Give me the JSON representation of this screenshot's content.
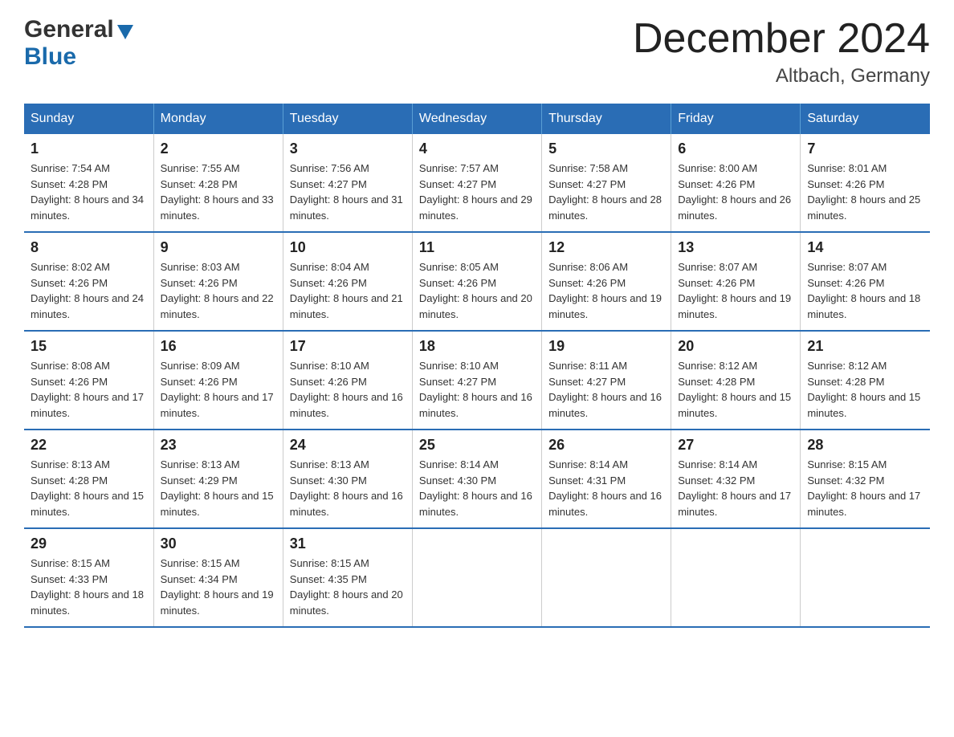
{
  "header": {
    "logo_text1": "General",
    "logo_text2": "Blue",
    "title": "December 2024",
    "location": "Altbach, Germany"
  },
  "calendar": {
    "days_of_week": [
      "Sunday",
      "Monday",
      "Tuesday",
      "Wednesday",
      "Thursday",
      "Friday",
      "Saturday"
    ],
    "weeks": [
      [
        {
          "day": "1",
          "sunrise": "7:54 AM",
          "sunset": "4:28 PM",
          "daylight": "8 hours and 34 minutes."
        },
        {
          "day": "2",
          "sunrise": "7:55 AM",
          "sunset": "4:28 PM",
          "daylight": "8 hours and 33 minutes."
        },
        {
          "day": "3",
          "sunrise": "7:56 AM",
          "sunset": "4:27 PM",
          "daylight": "8 hours and 31 minutes."
        },
        {
          "day": "4",
          "sunrise": "7:57 AM",
          "sunset": "4:27 PM",
          "daylight": "8 hours and 29 minutes."
        },
        {
          "day": "5",
          "sunrise": "7:58 AM",
          "sunset": "4:27 PM",
          "daylight": "8 hours and 28 minutes."
        },
        {
          "day": "6",
          "sunrise": "8:00 AM",
          "sunset": "4:26 PM",
          "daylight": "8 hours and 26 minutes."
        },
        {
          "day": "7",
          "sunrise": "8:01 AM",
          "sunset": "4:26 PM",
          "daylight": "8 hours and 25 minutes."
        }
      ],
      [
        {
          "day": "8",
          "sunrise": "8:02 AM",
          "sunset": "4:26 PM",
          "daylight": "8 hours and 24 minutes."
        },
        {
          "day": "9",
          "sunrise": "8:03 AM",
          "sunset": "4:26 PM",
          "daylight": "8 hours and 22 minutes."
        },
        {
          "day": "10",
          "sunrise": "8:04 AM",
          "sunset": "4:26 PM",
          "daylight": "8 hours and 21 minutes."
        },
        {
          "day": "11",
          "sunrise": "8:05 AM",
          "sunset": "4:26 PM",
          "daylight": "8 hours and 20 minutes."
        },
        {
          "day": "12",
          "sunrise": "8:06 AM",
          "sunset": "4:26 PM",
          "daylight": "8 hours and 19 minutes."
        },
        {
          "day": "13",
          "sunrise": "8:07 AM",
          "sunset": "4:26 PM",
          "daylight": "8 hours and 19 minutes."
        },
        {
          "day": "14",
          "sunrise": "8:07 AM",
          "sunset": "4:26 PM",
          "daylight": "8 hours and 18 minutes."
        }
      ],
      [
        {
          "day": "15",
          "sunrise": "8:08 AM",
          "sunset": "4:26 PM",
          "daylight": "8 hours and 17 minutes."
        },
        {
          "day": "16",
          "sunrise": "8:09 AM",
          "sunset": "4:26 PM",
          "daylight": "8 hours and 17 minutes."
        },
        {
          "day": "17",
          "sunrise": "8:10 AM",
          "sunset": "4:26 PM",
          "daylight": "8 hours and 16 minutes."
        },
        {
          "day": "18",
          "sunrise": "8:10 AM",
          "sunset": "4:27 PM",
          "daylight": "8 hours and 16 minutes."
        },
        {
          "day": "19",
          "sunrise": "8:11 AM",
          "sunset": "4:27 PM",
          "daylight": "8 hours and 16 minutes."
        },
        {
          "day": "20",
          "sunrise": "8:12 AM",
          "sunset": "4:28 PM",
          "daylight": "8 hours and 15 minutes."
        },
        {
          "day": "21",
          "sunrise": "8:12 AM",
          "sunset": "4:28 PM",
          "daylight": "8 hours and 15 minutes."
        }
      ],
      [
        {
          "day": "22",
          "sunrise": "8:13 AM",
          "sunset": "4:28 PM",
          "daylight": "8 hours and 15 minutes."
        },
        {
          "day": "23",
          "sunrise": "8:13 AM",
          "sunset": "4:29 PM",
          "daylight": "8 hours and 15 minutes."
        },
        {
          "day": "24",
          "sunrise": "8:13 AM",
          "sunset": "4:30 PM",
          "daylight": "8 hours and 16 minutes."
        },
        {
          "day": "25",
          "sunrise": "8:14 AM",
          "sunset": "4:30 PM",
          "daylight": "8 hours and 16 minutes."
        },
        {
          "day": "26",
          "sunrise": "8:14 AM",
          "sunset": "4:31 PM",
          "daylight": "8 hours and 16 minutes."
        },
        {
          "day": "27",
          "sunrise": "8:14 AM",
          "sunset": "4:32 PM",
          "daylight": "8 hours and 17 minutes."
        },
        {
          "day": "28",
          "sunrise": "8:15 AM",
          "sunset": "4:32 PM",
          "daylight": "8 hours and 17 minutes."
        }
      ],
      [
        {
          "day": "29",
          "sunrise": "8:15 AM",
          "sunset": "4:33 PM",
          "daylight": "8 hours and 18 minutes."
        },
        {
          "day": "30",
          "sunrise": "8:15 AM",
          "sunset": "4:34 PM",
          "daylight": "8 hours and 19 minutes."
        },
        {
          "day": "31",
          "sunrise": "8:15 AM",
          "sunset": "4:35 PM",
          "daylight": "8 hours and 20 minutes."
        },
        null,
        null,
        null,
        null
      ]
    ]
  }
}
